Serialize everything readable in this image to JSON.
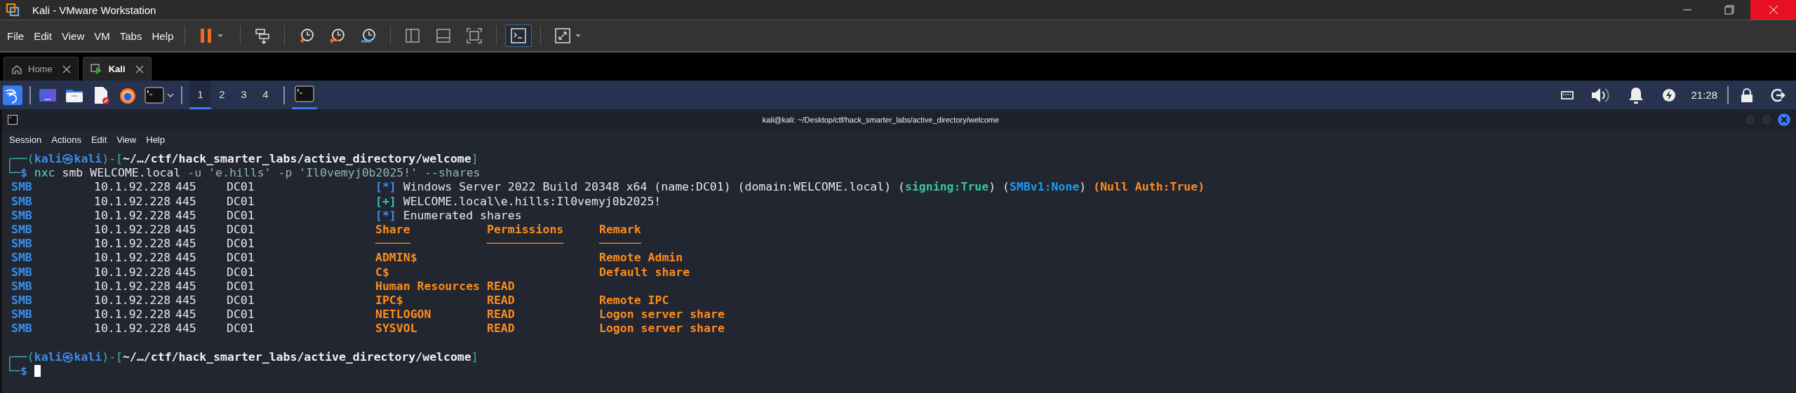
{
  "window": {
    "title": "Kali - VMware Workstation"
  },
  "menu": [
    "File",
    "Edit",
    "View",
    "VM",
    "Tabs",
    "Help"
  ],
  "toolbar": [
    {
      "kind": "pause",
      "selected": false
    },
    {
      "kind": "send-keys",
      "selected": false
    },
    {
      "kind": "snapshot-take",
      "selected": false
    },
    {
      "kind": "snapshot-revert",
      "selected": false
    },
    {
      "kind": "snapshot-manage",
      "selected": false
    },
    {
      "kind": "view-sidebar",
      "selected": false
    },
    {
      "kind": "view-thumbs",
      "selected": false
    },
    {
      "kind": "view-full",
      "selected": false
    },
    {
      "kind": "console",
      "selected": true
    },
    {
      "kind": "stretch",
      "selected": false
    }
  ],
  "tabs": [
    {
      "label": "Home",
      "kind": "home",
      "selected": false
    },
    {
      "label": "Kali",
      "kind": "vm",
      "selected": true
    }
  ],
  "panel": {
    "launchers": [
      {
        "kind": "menu"
      },
      {
        "kind": "desktop"
      },
      {
        "kind": "files"
      },
      {
        "kind": "editor"
      },
      {
        "kind": "browser"
      },
      {
        "kind": "terminal"
      }
    ],
    "workspaces": [
      {
        "label": "1",
        "selected": true
      },
      {
        "label": "2",
        "selected": false
      },
      {
        "label": "3",
        "selected": false
      },
      {
        "label": "4",
        "selected": false
      }
    ],
    "task": {
      "selected": true
    },
    "clock": "21:28"
  },
  "terminal": {
    "title": "kali@kali: ~/Desktop/ctf/hack_smarter_labs/active_directory/welcome",
    "menu": [
      "Session",
      "Actions",
      "Edit",
      "View",
      "Help"
    ],
    "prompts": [
      {
        "open": "┌──(",
        "user": "kali㉿kali",
        "sep": ")-[",
        "path": "~/…/ctf/hack_smarter_labs/active_directory/welcome",
        "close": "]",
        "corner": "└─",
        "symbol": "$"
      },
      {
        "open": "┌──(",
        "user": "kali㉿kali",
        "sep": ")-[",
        "path": "~/…/ctf/hack_smarter_labs/active_directory/welcome",
        "close": "]",
        "corner": "└─",
        "symbol": "$"
      }
    ],
    "command": [
      {
        "text": "nxc",
        "color": "#5fd7c8"
      },
      {
        "text": " smb WELCOME.local ",
        "color": "#e6e6e6"
      },
      {
        "text": "-u 'e.hills' -p 'Il0vemyj0b2025!' --shares",
        "color": "#8fb5b2"
      }
    ],
    "rows": [
      {
        "kind": "status",
        "protocol": "SMB",
        "ip": "10.1.92.228",
        "port": "445",
        "host": "DC01",
        "segments": [
          {
            "text": "[*]",
            "color": "#3b8eea",
            "bold": true
          },
          {
            "text": " Windows Server 2022 Build 20348 x64 (name:DC01) (domain:WELCOME.local) (",
            "color": "#e6e6e6",
            "bold": false
          },
          {
            "text": "signing:True",
            "color": "#35c5a5",
            "bold": true
          },
          {
            "text": ") (",
            "color": "#e6e6e6",
            "bold": false
          },
          {
            "text": "SMBv1:None",
            "color": "#1e9bf0",
            "bold": true
          },
          {
            "text": ") ",
            "color": "#e6e6e6",
            "bold": false
          },
          {
            "text": "(Null Auth:True)",
            "color": "#ff8c1a",
            "bold": true
          }
        ]
      },
      {
        "kind": "status",
        "protocol": "SMB",
        "ip": "10.1.92.228",
        "port": "445",
        "host": "DC01",
        "segments": [
          {
            "text": "[+]",
            "color": "#35c5a5",
            "bold": true
          },
          {
            "text": " WELCOME.local\\e.hills:Il0vemyj0b2025!",
            "color": "#e6e6e6",
            "bold": false
          }
        ]
      },
      {
        "kind": "status",
        "protocol": "SMB",
        "ip": "10.1.92.228",
        "port": "445",
        "host": "DC01",
        "segments": [
          {
            "text": "[*]",
            "color": "#3b8eea",
            "bold": true
          },
          {
            "text": " Enumerated shares",
            "color": "#e6e6e6",
            "bold": false
          }
        ]
      },
      {
        "kind": "table",
        "protocol": "SMB",
        "ip": "10.1.92.228",
        "port": "445",
        "host": "DC01",
        "cells": [
          "Share",
          "Permissions",
          "Remark"
        ]
      },
      {
        "kind": "table",
        "protocol": "SMB",
        "ip": "10.1.92.228",
        "port": "445",
        "host": "DC01",
        "cells": [
          "─────",
          "───────────",
          "──────"
        ]
      },
      {
        "kind": "table",
        "protocol": "SMB",
        "ip": "10.1.92.228",
        "port": "445",
        "host": "DC01",
        "cells": [
          "ADMIN$",
          "",
          "Remote Admin"
        ]
      },
      {
        "kind": "table",
        "protocol": "SMB",
        "ip": "10.1.92.228",
        "port": "445",
        "host": "DC01",
        "cells": [
          "C$",
          "",
          "Default share"
        ]
      },
      {
        "kind": "table",
        "protocol": "SMB",
        "ip": "10.1.92.228",
        "port": "445",
        "host": "DC01",
        "cells": [
          "Human Resources",
          "READ",
          ""
        ]
      },
      {
        "kind": "table",
        "protocol": "SMB",
        "ip": "10.1.92.228",
        "port": "445",
        "host": "DC01",
        "cells": [
          "IPC$",
          "READ",
          "Remote IPC"
        ]
      },
      {
        "kind": "table",
        "protocol": "SMB",
        "ip": "10.1.92.228",
        "port": "445",
        "host": "DC01",
        "cells": [
          "NETLOGON",
          "READ",
          "Logon server share"
        ]
      },
      {
        "kind": "table",
        "protocol": "SMB",
        "ip": "10.1.92.228",
        "port": "445",
        "host": "DC01",
        "cells": [
          "SYSVOL",
          "READ",
          "Logon server share"
        ]
      }
    ]
  }
}
